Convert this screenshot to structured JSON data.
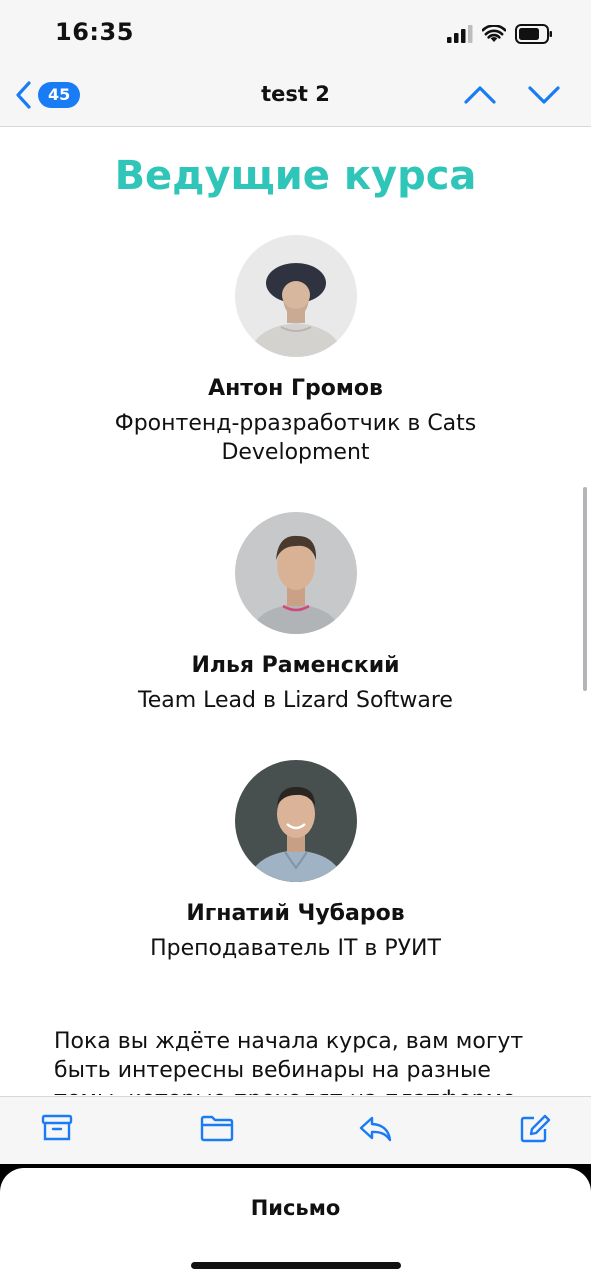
{
  "status_bar": {
    "time": "16:35"
  },
  "nav": {
    "badge": "45",
    "title": "test 2"
  },
  "content": {
    "section_title": "Ведущие курса",
    "people": [
      {
        "name": "Антон Громов",
        "role": "Фронтенд-рразработчик в Cats Development"
      },
      {
        "name": "Илья Раменский",
        "role": "Team Lead в Lizard Software"
      },
      {
        "name": "Игнатий Чубаров",
        "role": "Преподаватель IT в РУИТ"
      }
    ],
    "intro_text": "Пока вы ждёте начала курса, вам могут быть интересны вебинары на разные темы, которые проходят на платформе"
  },
  "sheet": {
    "title": "Письмо"
  },
  "colors": {
    "accent": "#2fc5b8",
    "link": "#1a7cf5"
  }
}
